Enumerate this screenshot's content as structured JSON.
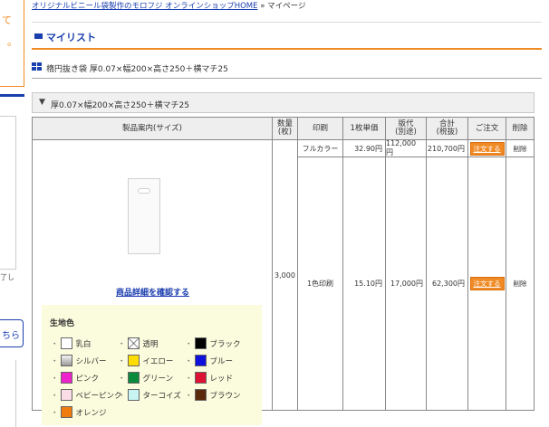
{
  "breadcrumb": {
    "home_link": "オリジナルビニール袋製作のモロフジ オンラインショップHOME",
    "separator": "»",
    "current": "マイページ"
  },
  "left_panel": {
    "text1": "て",
    "text2": "。",
    "small_text": "了し",
    "button_text": "ちら"
  },
  "page_title": "マイリスト",
  "product_heading": "楕円抜き袋 厚0.07×幅200×高さ250＋横マチ25",
  "collapse": {
    "arrow": "▼",
    "label": "厚0.07×幅200×高さ250＋横マチ25"
  },
  "table": {
    "headers": [
      "製品案内(サイズ)",
      "数量\n(枚)",
      "印刷",
      "1枚単価",
      "版代\n(別途)",
      "合計\n(税抜)",
      "ご注文",
      "削除"
    ],
    "quantity": "3,000",
    "rows": [
      {
        "print": "フルカラー",
        "unit_price": "32.90円",
        "plate_fee": "112,000円",
        "total": "210,700円",
        "order": "注文する",
        "delete": "削除"
      },
      {
        "print": "1色印刷",
        "unit_price": "15.10円",
        "plate_fee": "17,000円",
        "total": "62,300円",
        "order": "注文する",
        "delete": "削除"
      }
    ]
  },
  "detail_link": "商品詳細を確認する",
  "color_panel": {
    "title": "生地色",
    "colors": [
      {
        "name": "乳白",
        "hex": "#ffffff"
      },
      {
        "name": "透明",
        "hex": "transparent"
      },
      {
        "name": "ブラック",
        "hex": "#000000"
      },
      {
        "name": "シルバー",
        "hex": "#c0c0c0"
      },
      {
        "name": "イエロー",
        "hex": "#ffdd00"
      },
      {
        "name": "ブルー",
        "hex": "#1010dd"
      },
      {
        "name": "ピンク",
        "hex": "#ee22cc"
      },
      {
        "name": "グリーン",
        "hex": "#0a8a3a"
      },
      {
        "name": "レッド",
        "hex": "#dd1133"
      },
      {
        "name": "ベビーピンク",
        "hex": "#fadde6"
      },
      {
        "name": "ターコイズ",
        "hex": "#c8f4f4"
      },
      {
        "name": "ブラウン",
        "hex": "#5a2a0a"
      },
      {
        "name": "オレンジ",
        "hex": "#f07c10"
      }
    ]
  },
  "colors": {
    "accent": "#f08a24",
    "brand": "#1a3fae"
  }
}
